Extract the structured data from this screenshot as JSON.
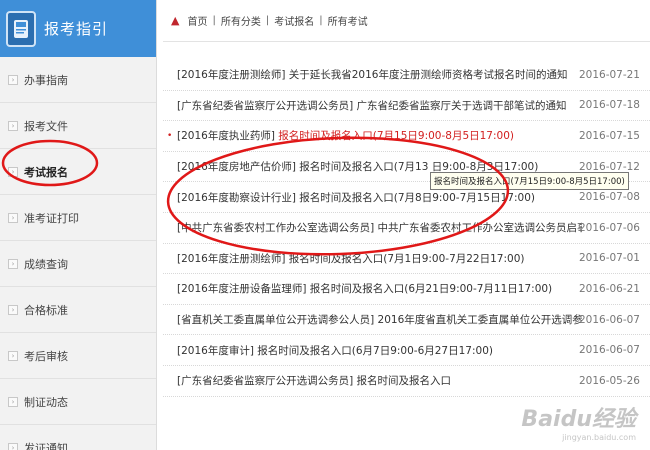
{
  "sidebar": {
    "title": "报考指引",
    "items": [
      {
        "label": "办事指南"
      },
      {
        "label": "报考文件"
      },
      {
        "label": "考试报名"
      },
      {
        "label": "准考证打印"
      },
      {
        "label": "成绩查询"
      },
      {
        "label": "合格标准"
      },
      {
        "label": "考后审核"
      },
      {
        "label": "制证动态"
      },
      {
        "label": "发证通知"
      }
    ]
  },
  "breadcrumb": [
    "首页",
    "所有分类",
    "考试报名",
    "所有考试"
  ],
  "notices": [
    {
      "prefix": "[2016年度注册测绘师] 关于延长我省2016年度注册测绘师资格考试报名时间的通知",
      "highlight": "",
      "date": "2016-07-21"
    },
    {
      "prefix": "[广东省纪委省监察厅公开选调公务员] 广东省纪委省监察厅关于选调干部笔试的通知",
      "highlight": "",
      "date": "2016-07-18"
    },
    {
      "prefix": "[2016年度执业药师] ",
      "highlight": "报名时间及报名入口(7月15日9:00-8月5日17:00)",
      "date": "2016-07-15"
    },
    {
      "prefix": "[2016年度房地产估价师] 报名时间及报名入口(7月13 日9:00-8月3日17:00)",
      "highlight": "",
      "date": "2016-07-12"
    },
    {
      "prefix": "[2016年度勘察设计行业] 报名时间及报名入口(7月8日9:00-7月15日17:00)",
      "highlight": "",
      "date": "2016-07-08"
    },
    {
      "prefix": "[中共广东省委农村工作办公室选调公务员] 中共广东省委农村工作办公室选调公务员启事",
      "highlight": "",
      "date": "2016-07-06"
    },
    {
      "prefix": "[2016年度注册测绘师] 报名时间及报名入口(7月1日9:00-7月22日17:00)",
      "highlight": "",
      "date": "2016-07-01"
    },
    {
      "prefix": "[2016年度注册设备监理师] 报名时间及报名入口(6月21日9:00-7月11日17:00)",
      "highlight": "",
      "date": "2016-06-21"
    },
    {
      "prefix": "[省直机关工委直属单位公开选调参公人员] 2016年度省直机关工委直属单位公开选调参公人员公告",
      "highlight": "",
      "date": "2016-06-07"
    },
    {
      "prefix": "[2016年度审计] 报名时间及报名入口(6月7日9:00-6月27日17:00)",
      "highlight": "",
      "date": "2016-06-07"
    },
    {
      "prefix": "[广东省纪委省监察厅公开选调公务员] 报名时间及报名入口",
      "highlight": "",
      "date": "2016-05-26"
    }
  ],
  "tooltip": "报名时间及报名入口(7月15日9:00-8月5日17:00)",
  "watermark": {
    "brand": "Baidu经验",
    "url": "jingyan.baidu.com"
  },
  "colors": {
    "header": "#3f8fd8",
    "highlight": "#d21f1f",
    "annotation": "#e01818"
  }
}
